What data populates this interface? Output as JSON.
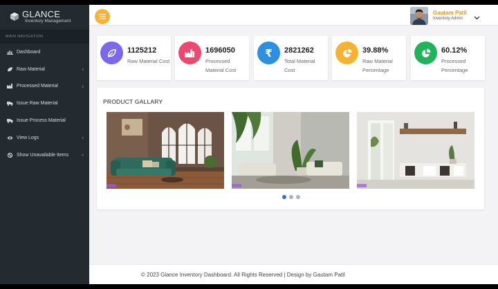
{
  "brand": {
    "title": "GLANCE",
    "subtitle": "Inventory Management",
    "logo_icon": "cube-icon"
  },
  "sidebar": {
    "header": "MAIN NAVIGATION",
    "items": [
      {
        "label": "Dashboard",
        "icon": "bar-chart-icon",
        "has_submenu": false
      },
      {
        "label": "Raw Material",
        "icon": "leaf-icon",
        "has_submenu": true
      },
      {
        "label": "Processed Material",
        "icon": "factory-icon",
        "has_submenu": true
      },
      {
        "label": "Issue Raw Material",
        "icon": "truck-icon",
        "has_submenu": false
      },
      {
        "label": "Issue Process Material",
        "icon": "truck-icon",
        "has_submenu": false
      },
      {
        "label": "View Logs",
        "icon": "eye-icon",
        "has_submenu": true
      },
      {
        "label": "Show Unavailable Items",
        "icon": "ban-icon",
        "has_submenu": true
      }
    ]
  },
  "header": {
    "menu_icon": "list-icon",
    "user": {
      "name": "Gautam Patil",
      "role": "Inventory Admin"
    }
  },
  "stats": [
    {
      "value": "1125212",
      "label": "Raw Material Cost",
      "color": "#7b68ee",
      "icon": "leaf-icon"
    },
    {
      "value": "1696050",
      "label": "Processed Material Cost",
      "color": "#f0476e",
      "icon": "factory-icon"
    },
    {
      "value": "2821262",
      "label": "Total Material Cost",
      "color": "#2d8fe0",
      "icon": "rupee-icon"
    },
    {
      "value": "39.88%",
      "label": "Raw Material Percentage",
      "color": "#f8b230",
      "icon": "pie-chart-icon"
    },
    {
      "value": "60.12%",
      "label": "Processed Percentage",
      "color": "#1fb45a",
      "icon": "pie-chart-icon"
    }
  ],
  "gallery": {
    "title": "PRODUCT GALLARY",
    "slides": 3,
    "active_slide": 1
  },
  "footer": {
    "text": "© 2023 Glance Inventory Dashboard. All Rights Reserved | Design by Gautam Patil"
  }
}
